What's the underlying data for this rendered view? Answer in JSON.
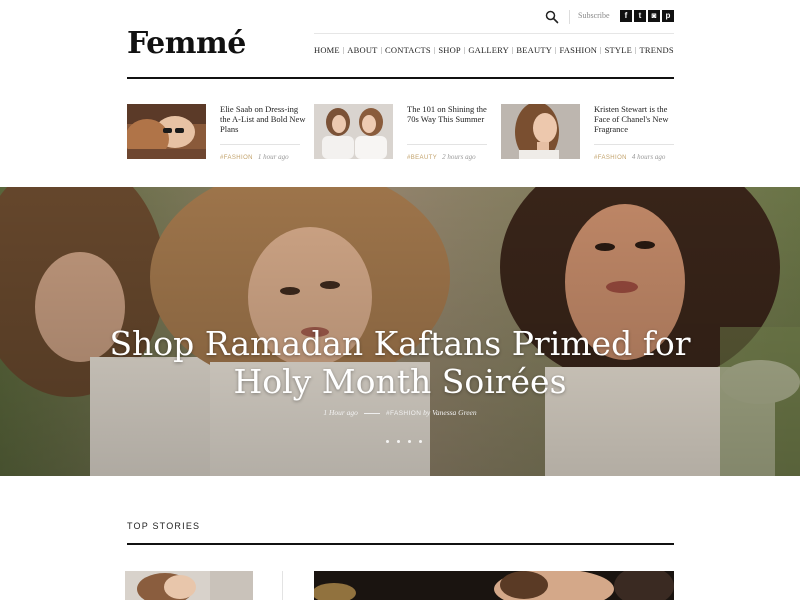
{
  "header": {
    "logo": "Femmé",
    "subscribe_label": "Subscribe",
    "search_icon": "search-icon",
    "social": [
      {
        "name": "facebook-icon",
        "glyph": "f"
      },
      {
        "name": "twitter-icon",
        "glyph": "t"
      },
      {
        "name": "instagram-icon",
        "glyph": "◙"
      },
      {
        "name": "pinterest-icon",
        "glyph": "p"
      }
    ]
  },
  "nav": {
    "items": [
      "HOME",
      "ABOUT",
      "CONTACTS",
      "SHOP",
      "GALLERY",
      "BEAUTY",
      "FASHION",
      "STYLE",
      "TRENDS"
    ]
  },
  "mini_posts": [
    {
      "title": "Elie Saab on Dress-ing the A-List and Bold New Plans",
      "category": "#FASHION",
      "time": "1 hour ago"
    },
    {
      "title": "The 101 on Shining the 70s Way This Summer",
      "category": "#BEAUTY",
      "time": "2 hours ago"
    },
    {
      "title": "Kristen Stewart is the Face of Chanel's New Fragrance",
      "category": "#FASHION",
      "time": "4 hours ago"
    }
  ],
  "hero": {
    "title_line1": "Shop Ramadan Kaftans Primed for",
    "title_line2": "Holy Month Soirées",
    "time": "1 Hour ago",
    "category": "#FASHION",
    "author": "by Vanessa Green",
    "slides": 4
  },
  "top_stories": {
    "title": "TOP STORIES"
  },
  "colors": {
    "accent": "#c2a26b",
    "text": "#222222",
    "rule": "#111111"
  }
}
